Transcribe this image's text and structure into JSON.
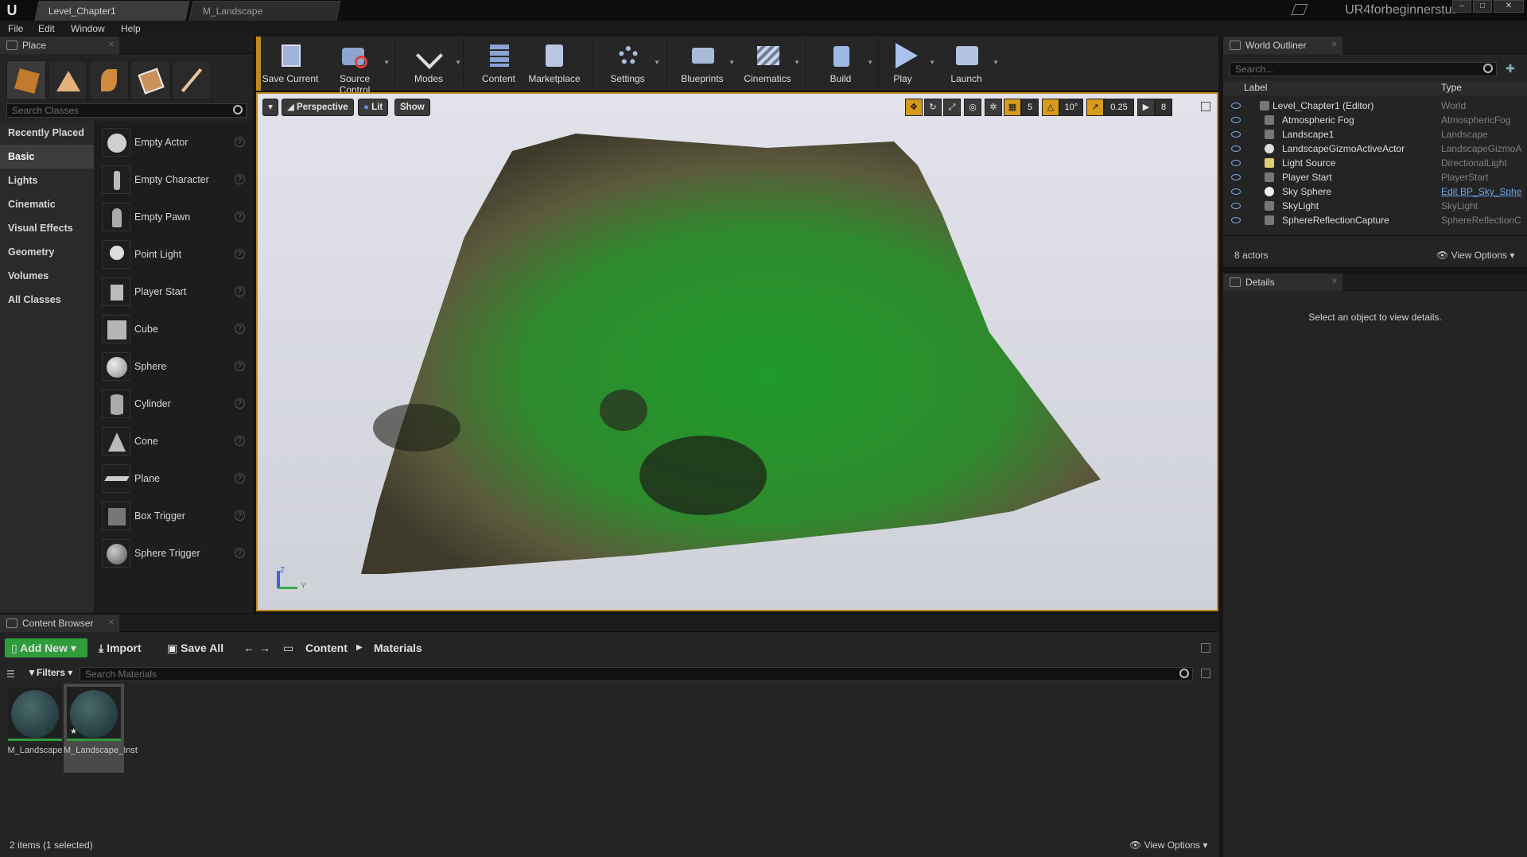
{
  "app": {
    "logo": "U",
    "project": "UR4forbeginnerstut"
  },
  "tabs": [
    {
      "label": "Level_Chapter1"
    },
    {
      "label": "M_Landscape"
    }
  ],
  "menu": [
    "File",
    "Edit",
    "Window",
    "Help"
  ],
  "place": {
    "tab": "Place",
    "search_placeholder": "Search Classes",
    "categories": [
      "Recently Placed",
      "Basic",
      "Lights",
      "Cinematic",
      "Visual Effects",
      "Geometry",
      "Volumes",
      "All Classes"
    ],
    "selected_category": "Basic",
    "items": [
      "Empty Actor",
      "Empty Character",
      "Empty Pawn",
      "Point Light",
      "Player Start",
      "Cube",
      "Sphere",
      "Cylinder",
      "Cone",
      "Plane",
      "Box Trigger",
      "Sphere Trigger"
    ]
  },
  "toolbar": {
    "buttons": [
      "Save Current",
      "Source Control",
      "Modes",
      "Content",
      "Marketplace",
      "Settings",
      "Blueprints",
      "Cinematics",
      "Build",
      "Play",
      "Launch"
    ]
  },
  "viewport": {
    "perspective": "Perspective",
    "lit": "Lit",
    "show": "Show",
    "grid_snap": "5",
    "rot_snap": "10°",
    "scale_snap": "0.25",
    "cam_speed": "8",
    "axis_labels": {
      "z": "Z",
      "y": "Y"
    }
  },
  "outliner": {
    "tab": "World Outliner",
    "search_placeholder": "Search...",
    "col_label": "Label",
    "col_type": "Type",
    "rows": [
      {
        "label": "Level_Chapter1 (Editor)",
        "type": "World"
      },
      {
        "label": "Atmospheric Fog",
        "type": "AtmosphericFog"
      },
      {
        "label": "Landscape1",
        "type": "Landscape"
      },
      {
        "label": "LandscapeGizmoActiveActor",
        "type": "LandscapeGizmoA"
      },
      {
        "label": "Light Source",
        "type": "DirectionalLight"
      },
      {
        "label": "Player Start",
        "type": "PlayerStart"
      },
      {
        "label": "Sky Sphere",
        "type": "Edit BP_Sky_Sphe"
      },
      {
        "label": "SkyLight",
        "type": "SkyLight"
      },
      {
        "label": "SphereReflectionCapture",
        "type": "SphereReflectionC"
      }
    ],
    "count": "8 actors",
    "view_options": "View Options"
  },
  "details": {
    "tab": "Details",
    "empty_msg": "Select an object to view details."
  },
  "content_browser": {
    "tab": "Content Browser",
    "add_new": "Add New",
    "import": "Import",
    "save_all": "Save All",
    "path": [
      "Content",
      "Materials"
    ],
    "filters": "Filters",
    "search_placeholder": "Search Materials",
    "assets": [
      {
        "label": "M_Landscape"
      },
      {
        "label": "M_Landscape_Inst"
      }
    ],
    "status": "2 items (1 selected)",
    "view_options": "View Options"
  },
  "colors": {
    "accent": "#c08a1f",
    "green": "#2f9c3c",
    "link": "#6fa3e8"
  }
}
